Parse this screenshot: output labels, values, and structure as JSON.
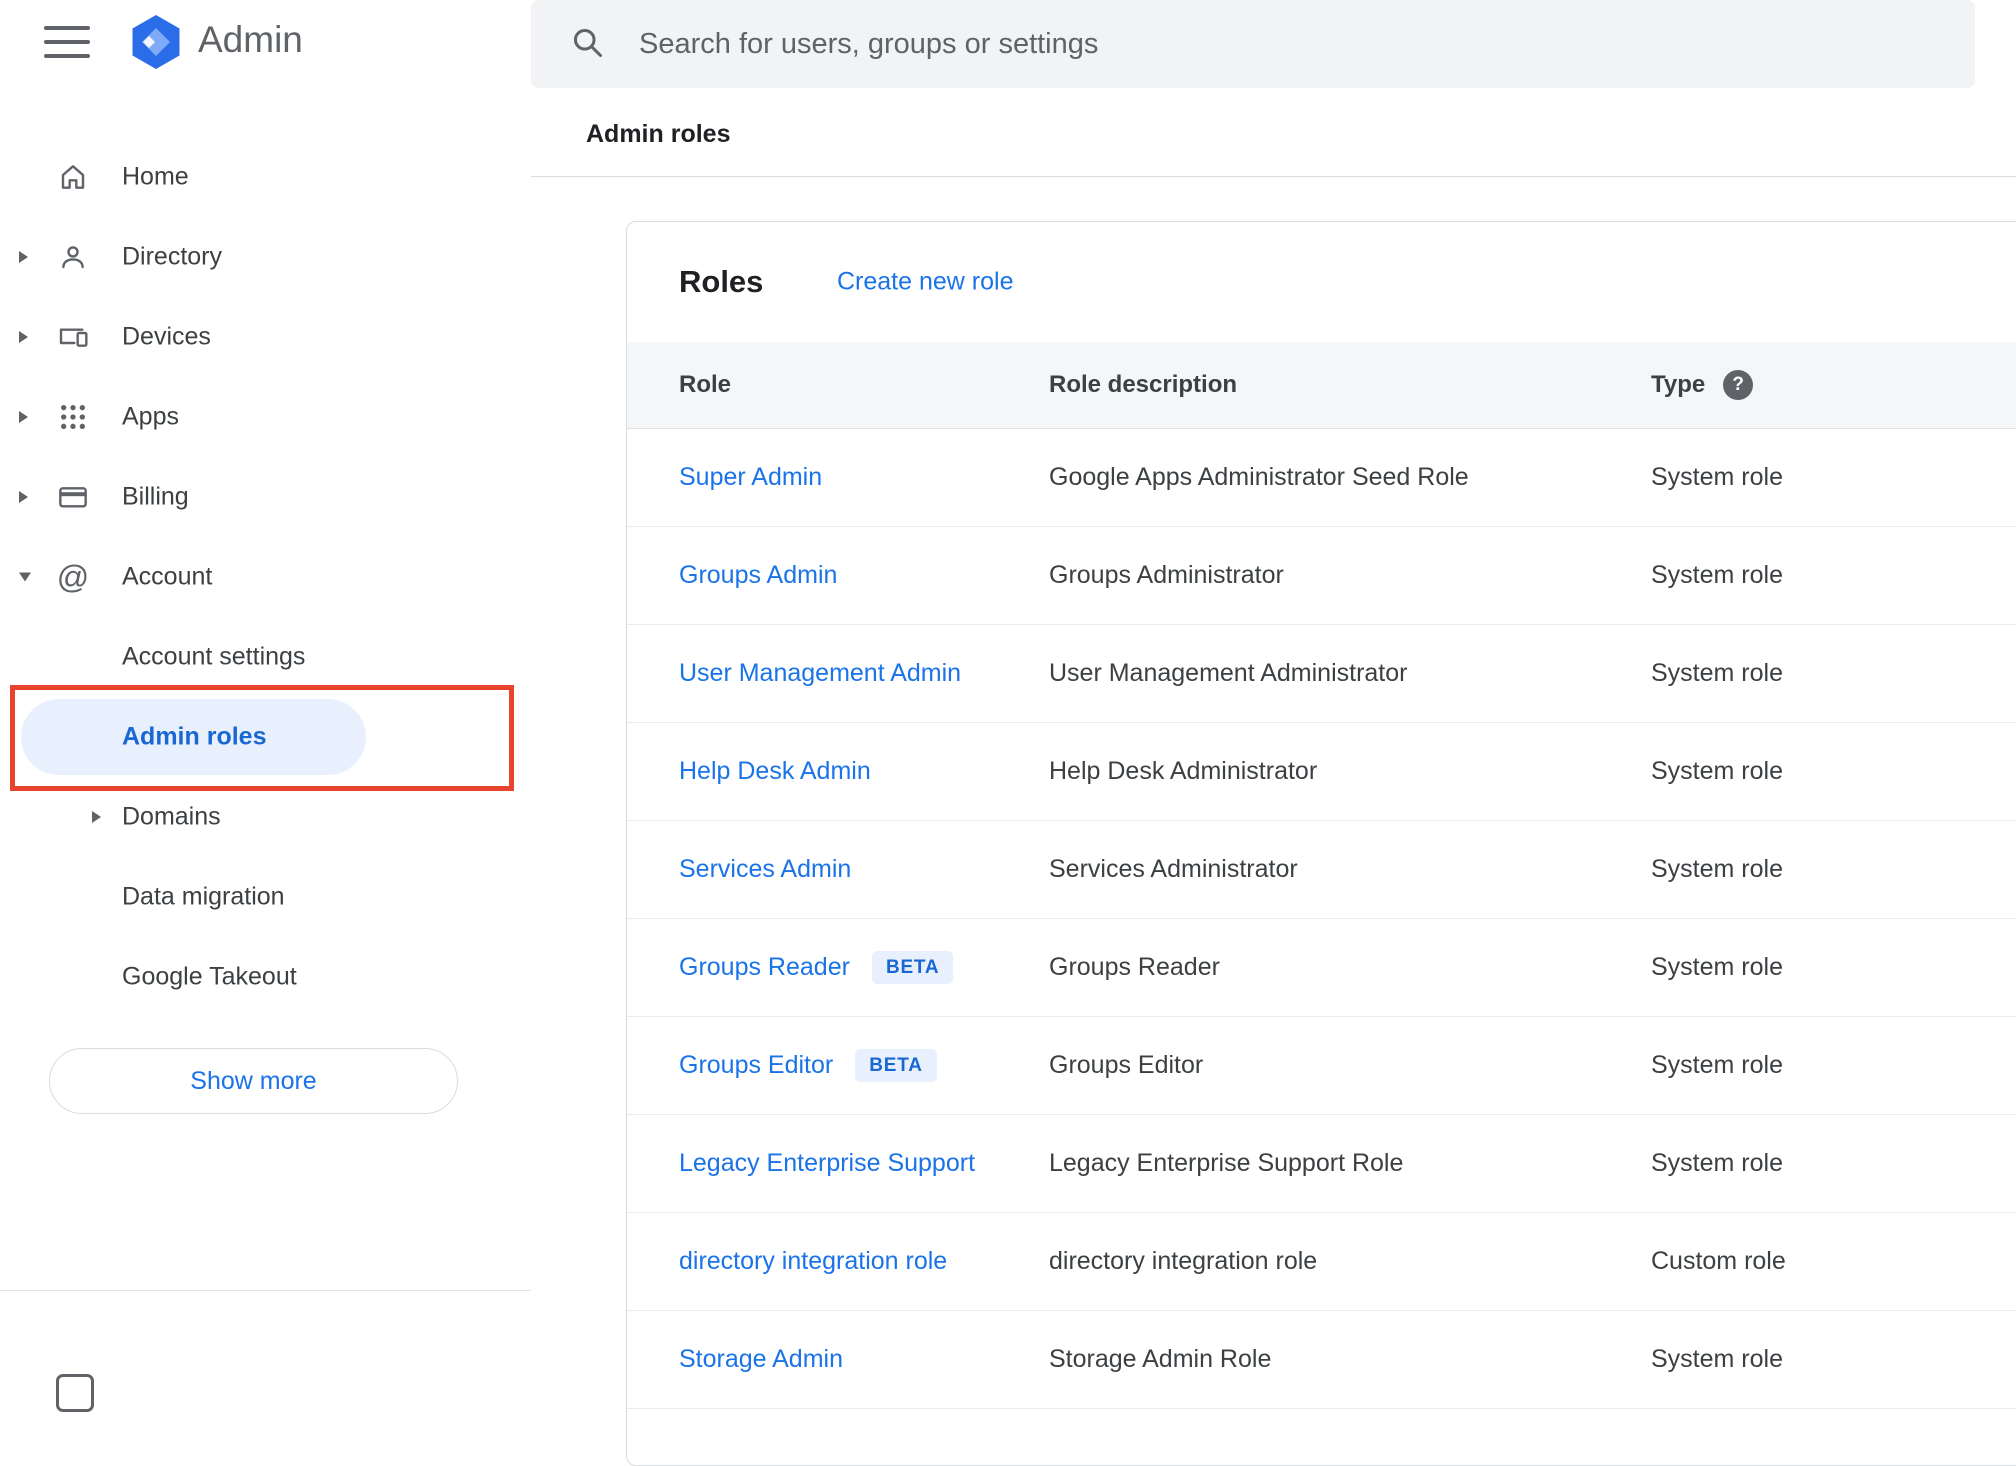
{
  "topbar": {
    "brand": "Admin",
    "search_placeholder": "Search for users, groups or settings"
  },
  "page": {
    "title": "Admin roles"
  },
  "sidebar": {
    "items": [
      {
        "label": "Home"
      },
      {
        "label": "Directory"
      },
      {
        "label": "Devices"
      },
      {
        "label": "Apps"
      },
      {
        "label": "Billing"
      },
      {
        "label": "Account"
      }
    ],
    "account_children": [
      {
        "label": "Account settings"
      },
      {
        "label": "Admin roles",
        "active": true
      },
      {
        "label": "Domains"
      },
      {
        "label": "Data migration"
      },
      {
        "label": "Google Takeout"
      }
    ],
    "show_more_label": "Show more"
  },
  "roles_card": {
    "title": "Roles",
    "create_link_label": "Create new role",
    "columns": [
      "Role",
      "Role description",
      "Type"
    ],
    "rows": [
      {
        "role": "Super Admin",
        "description": "Google Apps Administrator Seed Role",
        "type": "System role"
      },
      {
        "role": "Groups Admin",
        "description": "Groups Administrator",
        "type": "System role"
      },
      {
        "role": "User Management Admin",
        "description": "User Management Administrator",
        "type": "System role"
      },
      {
        "role": "Help Desk Admin",
        "description": "Help Desk Administrator",
        "type": "System role"
      },
      {
        "role": "Services Admin",
        "description": "Services Administrator",
        "type": "System role"
      },
      {
        "role": "Groups Reader",
        "badge": "BETA",
        "description": "Groups Reader",
        "type": "System role"
      },
      {
        "role": "Groups Editor",
        "badge": "BETA",
        "description": "Groups Editor",
        "type": "System role"
      },
      {
        "role": "Legacy Enterprise Support",
        "description": "Legacy Enterprise Support Role",
        "type": "System role"
      },
      {
        "role": "directory integration role",
        "description": "directory integration role",
        "type": "Custom role"
      },
      {
        "role": "Storage Admin",
        "description": "Storage Admin Role",
        "type": "System role"
      }
    ]
  },
  "icons": {
    "help_glyph": "?",
    "at_glyph": "@"
  },
  "colors": {
    "link_blue": "#1a73e8",
    "active_blue": "#1967d2",
    "active_bg": "#e8f0fe",
    "annotation_red": "#e8432d",
    "search_bg": "#f1f3f4",
    "table_header_bg": "#f5f6f7",
    "divider": "#dadce0"
  }
}
